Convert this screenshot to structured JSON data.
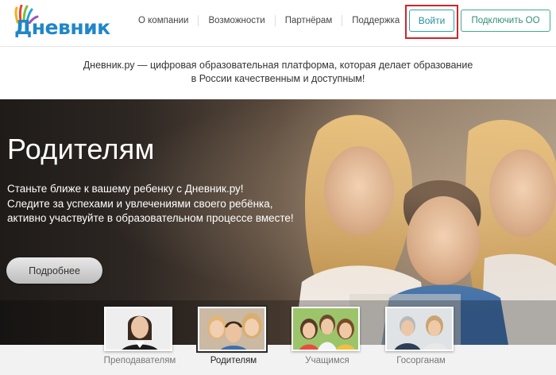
{
  "header": {
    "logo_text": "Дневник",
    "nav": [
      "О компании",
      "Возможности",
      "Партнёрам",
      "Поддержка"
    ],
    "login_label": "Войти",
    "connect_label": "Подключить ОО"
  },
  "tagline": {
    "line1": "Дневник.ру — цифровая образовательная платформа, которая делает образование",
    "line2": "в России качественным и доступным!"
  },
  "hero": {
    "title": "Родителям",
    "text_line1": "Станьте ближе к вашему ребенку с Дневник.ру!",
    "text_line2": "Следите за успехами и увлечениями своего ребёнка,",
    "text_line3": "активно участвуйте в образовательном процессе вместе!",
    "more_label": "Подробнее"
  },
  "tabs": [
    {
      "label": "Преподавателям",
      "active": false
    },
    {
      "label": "Родителям",
      "active": true
    },
    {
      "label": "Учащимся",
      "active": false
    },
    {
      "label": "Госорганам",
      "active": false
    }
  ],
  "colors": {
    "brand_blue": "#1f86c9",
    "login_teal": "#2ba3b0",
    "connect_green": "#43a98e",
    "highlight_red": "#d4222a"
  }
}
